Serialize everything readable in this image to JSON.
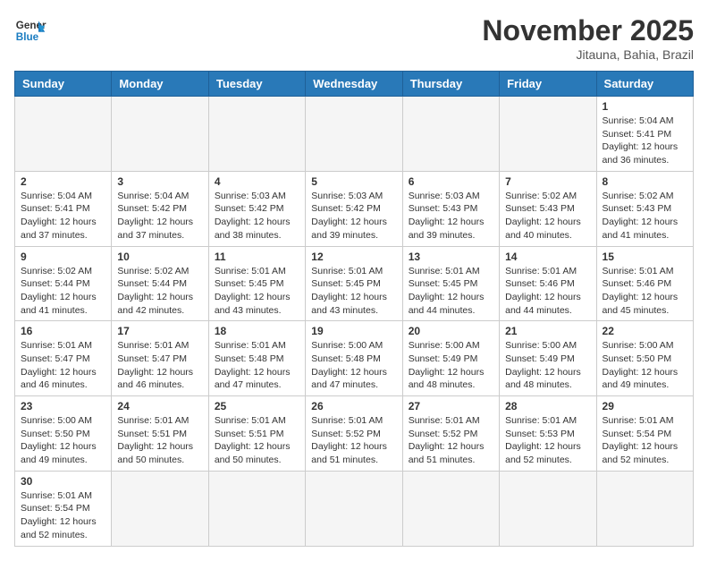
{
  "header": {
    "logo_general": "General",
    "logo_blue": "Blue",
    "month_title": "November 2025",
    "location": "Jitauna, Bahia, Brazil"
  },
  "weekdays": [
    "Sunday",
    "Monday",
    "Tuesday",
    "Wednesday",
    "Thursday",
    "Friday",
    "Saturday"
  ],
  "weeks": [
    [
      {
        "day": "",
        "empty": true
      },
      {
        "day": "",
        "empty": true
      },
      {
        "day": "",
        "empty": true
      },
      {
        "day": "",
        "empty": true
      },
      {
        "day": "",
        "empty": true
      },
      {
        "day": "",
        "empty": true
      },
      {
        "day": "1",
        "sunrise": "5:04 AM",
        "sunset": "5:41 PM",
        "daylight": "12 hours and 36 minutes."
      }
    ],
    [
      {
        "day": "2",
        "sunrise": "5:04 AM",
        "sunset": "5:41 PM",
        "daylight": "12 hours and 37 minutes."
      },
      {
        "day": "3",
        "sunrise": "5:04 AM",
        "sunset": "5:42 PM",
        "daylight": "12 hours and 37 minutes."
      },
      {
        "day": "4",
        "sunrise": "5:03 AM",
        "sunset": "5:42 PM",
        "daylight": "12 hours and 38 minutes."
      },
      {
        "day": "5",
        "sunrise": "5:03 AM",
        "sunset": "5:42 PM",
        "daylight": "12 hours and 39 minutes."
      },
      {
        "day": "6",
        "sunrise": "5:03 AM",
        "sunset": "5:43 PM",
        "daylight": "12 hours and 39 minutes."
      },
      {
        "day": "7",
        "sunrise": "5:02 AM",
        "sunset": "5:43 PM",
        "daylight": "12 hours and 40 minutes."
      },
      {
        "day": "8",
        "sunrise": "5:02 AM",
        "sunset": "5:43 PM",
        "daylight": "12 hours and 41 minutes."
      }
    ],
    [
      {
        "day": "9",
        "sunrise": "5:02 AM",
        "sunset": "5:44 PM",
        "daylight": "12 hours and 41 minutes."
      },
      {
        "day": "10",
        "sunrise": "5:02 AM",
        "sunset": "5:44 PM",
        "daylight": "12 hours and 42 minutes."
      },
      {
        "day": "11",
        "sunrise": "5:01 AM",
        "sunset": "5:45 PM",
        "daylight": "12 hours and 43 minutes."
      },
      {
        "day": "12",
        "sunrise": "5:01 AM",
        "sunset": "5:45 PM",
        "daylight": "12 hours and 43 minutes."
      },
      {
        "day": "13",
        "sunrise": "5:01 AM",
        "sunset": "5:45 PM",
        "daylight": "12 hours and 44 minutes."
      },
      {
        "day": "14",
        "sunrise": "5:01 AM",
        "sunset": "5:46 PM",
        "daylight": "12 hours and 44 minutes."
      },
      {
        "day": "15",
        "sunrise": "5:01 AM",
        "sunset": "5:46 PM",
        "daylight": "12 hours and 45 minutes."
      }
    ],
    [
      {
        "day": "16",
        "sunrise": "5:01 AM",
        "sunset": "5:47 PM",
        "daylight": "12 hours and 46 minutes."
      },
      {
        "day": "17",
        "sunrise": "5:01 AM",
        "sunset": "5:47 PM",
        "daylight": "12 hours and 46 minutes."
      },
      {
        "day": "18",
        "sunrise": "5:01 AM",
        "sunset": "5:48 PM",
        "daylight": "12 hours and 47 minutes."
      },
      {
        "day": "19",
        "sunrise": "5:00 AM",
        "sunset": "5:48 PM",
        "daylight": "12 hours and 47 minutes."
      },
      {
        "day": "20",
        "sunrise": "5:00 AM",
        "sunset": "5:49 PM",
        "daylight": "12 hours and 48 minutes."
      },
      {
        "day": "21",
        "sunrise": "5:00 AM",
        "sunset": "5:49 PM",
        "daylight": "12 hours and 48 minutes."
      },
      {
        "day": "22",
        "sunrise": "5:00 AM",
        "sunset": "5:50 PM",
        "daylight": "12 hours and 49 minutes."
      }
    ],
    [
      {
        "day": "23",
        "sunrise": "5:00 AM",
        "sunset": "5:50 PM",
        "daylight": "12 hours and 49 minutes."
      },
      {
        "day": "24",
        "sunrise": "5:01 AM",
        "sunset": "5:51 PM",
        "daylight": "12 hours and 50 minutes."
      },
      {
        "day": "25",
        "sunrise": "5:01 AM",
        "sunset": "5:51 PM",
        "daylight": "12 hours and 50 minutes."
      },
      {
        "day": "26",
        "sunrise": "5:01 AM",
        "sunset": "5:52 PM",
        "daylight": "12 hours and 51 minutes."
      },
      {
        "day": "27",
        "sunrise": "5:01 AM",
        "sunset": "5:52 PM",
        "daylight": "12 hours and 51 minutes."
      },
      {
        "day": "28",
        "sunrise": "5:01 AM",
        "sunset": "5:53 PM",
        "daylight": "12 hours and 52 minutes."
      },
      {
        "day": "29",
        "sunrise": "5:01 AM",
        "sunset": "5:54 PM",
        "daylight": "12 hours and 52 minutes."
      }
    ],
    [
      {
        "day": "30",
        "sunrise": "5:01 AM",
        "sunset": "5:54 PM",
        "daylight": "12 hours and 52 minutes."
      },
      {
        "day": "",
        "empty": true
      },
      {
        "day": "",
        "empty": true
      },
      {
        "day": "",
        "empty": true
      },
      {
        "day": "",
        "empty": true
      },
      {
        "day": "",
        "empty": true
      },
      {
        "day": "",
        "empty": true
      }
    ]
  ],
  "labels": {
    "sunrise": "Sunrise: ",
    "sunset": "Sunset: ",
    "daylight": "Daylight: "
  }
}
